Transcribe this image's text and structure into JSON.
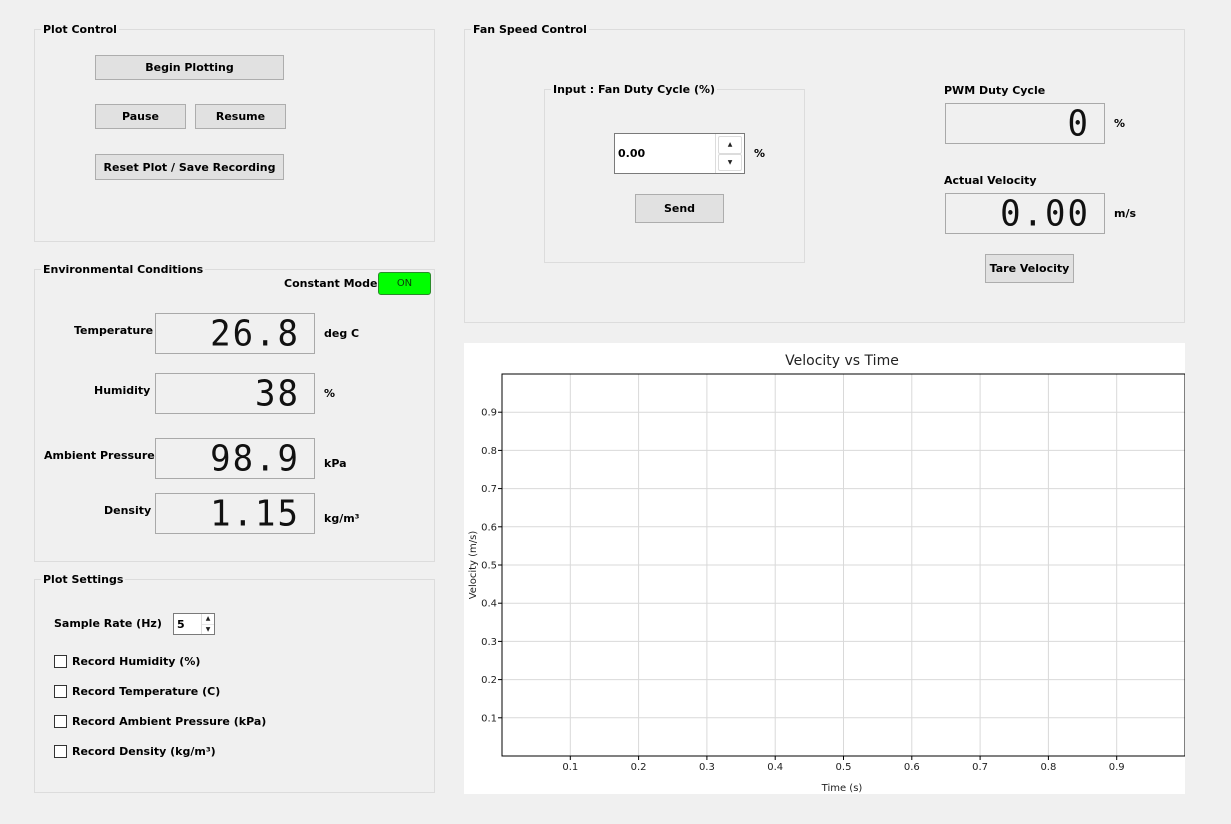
{
  "plot_control": {
    "title": "Plot Control",
    "begin_label": "Begin Plotting",
    "pause_label": "Pause",
    "resume_label": "Resume",
    "reset_label": "Reset Plot / Save Recording"
  },
  "environment": {
    "title": "Environmental Conditions",
    "constant_mode_label": "Constant Mode:",
    "constant_mode_value": "ON",
    "temperature": {
      "label": "Temperature",
      "value": "26.8",
      "unit": "deg C"
    },
    "humidity": {
      "label": "Humidity",
      "value": "38",
      "unit": "%"
    },
    "pressure": {
      "label": "Ambient Pressure",
      "value": "98.9",
      "unit": "kPa"
    },
    "density": {
      "label": "Density",
      "value": "1.15",
      "unit": "kg/m³"
    }
  },
  "plot_settings": {
    "title": "Plot Settings",
    "sample_rate_label": "Sample Rate (Hz)",
    "sample_rate_value": "5",
    "checks": [
      {
        "label": "Record Humidity (%)",
        "checked": false
      },
      {
        "label": "Record Temperature (C)",
        "checked": false
      },
      {
        "label": "Record Ambient Pressure (kPa)",
        "checked": false
      },
      {
        "label": "Record Density (kg/m³)",
        "checked": false
      }
    ]
  },
  "fan_control": {
    "title": "Fan Speed Control",
    "input_group_title": "Input :  Fan Duty Cycle (%)",
    "duty_value": "0.00",
    "duty_unit": "%",
    "send_label": "Send",
    "pwm_label": "PWM Duty Cycle",
    "pwm_value": "0",
    "pwm_unit": "%",
    "velocity_label": "Actual Velocity",
    "velocity_value": "0.00",
    "velocity_unit": "m/s",
    "tare_label": "Tare Velocity"
  },
  "chart_data": {
    "type": "line",
    "title": "Velocity vs Time",
    "xlabel": "Time (s)",
    "ylabel": "Velocity (m/s)",
    "xlim": [
      0,
      1
    ],
    "ylim": [
      0,
      1
    ],
    "xticks": [
      "0.1",
      "0.2",
      "0.3",
      "0.4",
      "0.5",
      "0.6",
      "0.7",
      "0.8",
      "0.9"
    ],
    "yticks": [
      "0.1",
      "0.2",
      "0.3",
      "0.4",
      "0.5",
      "0.6",
      "0.7",
      "0.8",
      "0.9"
    ],
    "grid": true,
    "series": []
  },
  "colors": {
    "toggle_on": "#00ff00",
    "background": "#f0f0f0"
  }
}
